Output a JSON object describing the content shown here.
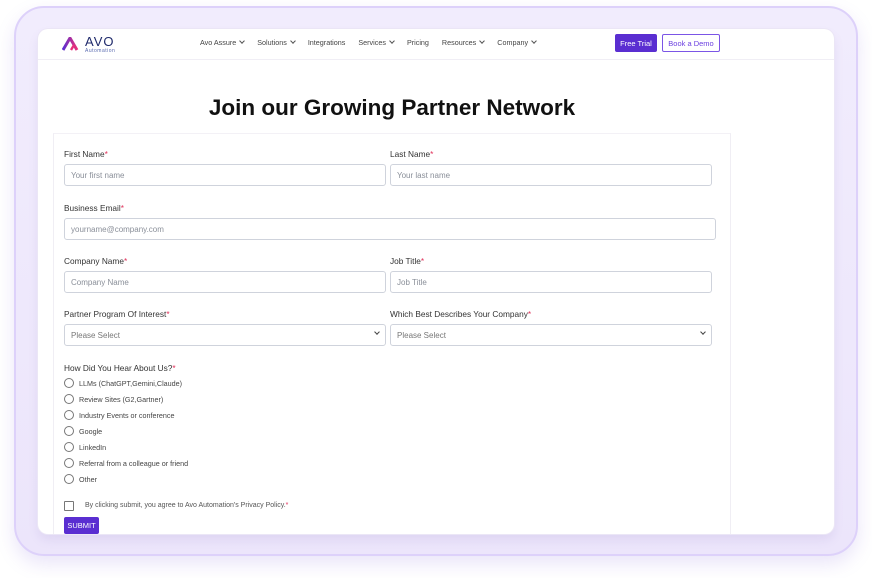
{
  "brand": {
    "name": "AVO",
    "tagline": "Automation",
    "colors": {
      "primary": "#5a2ed1",
      "accent": "#e8307a"
    }
  },
  "nav": {
    "items": [
      {
        "label": "Avo Assure",
        "dropdown": true
      },
      {
        "label": "Solutions",
        "dropdown": true
      },
      {
        "label": "Integrations",
        "dropdown": false
      },
      {
        "label": "Services",
        "dropdown": true
      },
      {
        "label": "Pricing",
        "dropdown": false
      },
      {
        "label": "Resources",
        "dropdown": true
      },
      {
        "label": "Company",
        "dropdown": true
      }
    ],
    "free_trial": "Free Trial",
    "book_demo": "Book a Demo"
  },
  "page": {
    "heading": "Join our Growing Partner Network"
  },
  "form": {
    "first_name": {
      "label": "First Name",
      "placeholder": "Your first name"
    },
    "last_name": {
      "label": "Last Name",
      "placeholder": "Your last name"
    },
    "email": {
      "label": "Business Email",
      "placeholder": "yourname@company.com"
    },
    "company": {
      "label": "Company Name",
      "placeholder": "Company Name"
    },
    "job_title": {
      "label": "Job Title",
      "placeholder": "Job Title"
    },
    "program": {
      "label": "Partner Program Of Interest",
      "value": "Please Select"
    },
    "describes": {
      "label": "Which Best Describes Your Company",
      "value": "Please Select"
    },
    "hear_about": {
      "label": "How Did You Hear About Us?",
      "options": [
        "LLMs (ChatGPT,Gemini,Claude)",
        "Review Sites (G2,Gartner)",
        "Industry Events or conference",
        "Google",
        "LinkedIn",
        "Referral from a colleague or friend",
        "Other"
      ]
    },
    "required_mark": "*",
    "consent": "By clicking submit, you agree to Avo Automation's Privacy Policy.",
    "submit": "SUBMIT"
  }
}
